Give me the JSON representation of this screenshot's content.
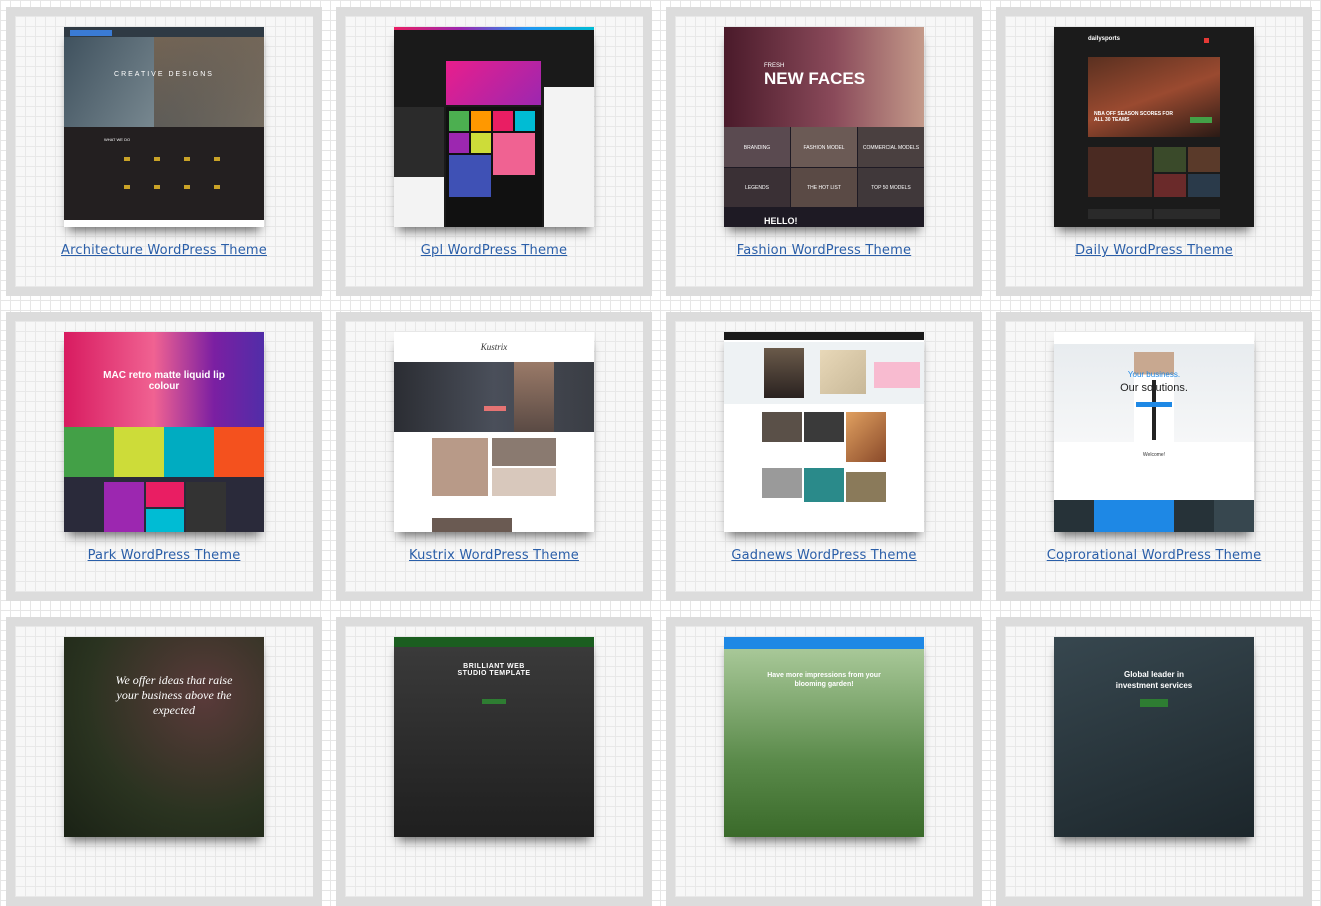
{
  "themes": [
    {
      "title": "Architecture WordPress Theme",
      "thumb_text": [
        "CREATIVE DESIGNS",
        "WHAT WE DO"
      ]
    },
    {
      "title": "Gpl WordPress Theme",
      "thumb_text": []
    },
    {
      "title": "Fashion WordPress Theme",
      "thumb_text": [
        "FRESH",
        "NEW FACES",
        "BRANDING",
        "FASHION MODEL",
        "COMMERCIAL MODELS",
        "LEGENDS",
        "THE HOT LIST",
        "TOP 50 MODELS",
        "HELLO!"
      ]
    },
    {
      "title": "Daily WordPress Theme",
      "thumb_text": [
        "dailysports",
        "NBA OFF SEASON SCORES FOR ALL 30 TEAMS"
      ]
    },
    {
      "title": "Park WordPress Theme",
      "thumb_text": [
        "MAC retro matte liquid lip colour"
      ]
    },
    {
      "title": "Kustrix WordPress Theme",
      "thumb_text": [
        "Kustrix"
      ]
    },
    {
      "title": "Gadnews WordPress Theme",
      "thumb_text": []
    },
    {
      "title": "Coprorational WordPress Theme",
      "thumb_text": [
        "Your business.",
        "Our solutions.",
        "Welcome!"
      ]
    },
    {
      "title": "",
      "thumb_text": [
        "We offer ideas that raise your business above the expected"
      ]
    },
    {
      "title": "",
      "thumb_text": [
        "BRILLIANT WEB STUDIO TEMPLATE"
      ]
    },
    {
      "title": "",
      "thumb_text": [
        "Have more impressions from your blooming garden!"
      ]
    },
    {
      "title": "",
      "thumb_text": [
        "Global leader in investment services"
      ]
    }
  ],
  "colors": {
    "card_border": "#dcdcdc",
    "link": "#2a5ea8"
  }
}
